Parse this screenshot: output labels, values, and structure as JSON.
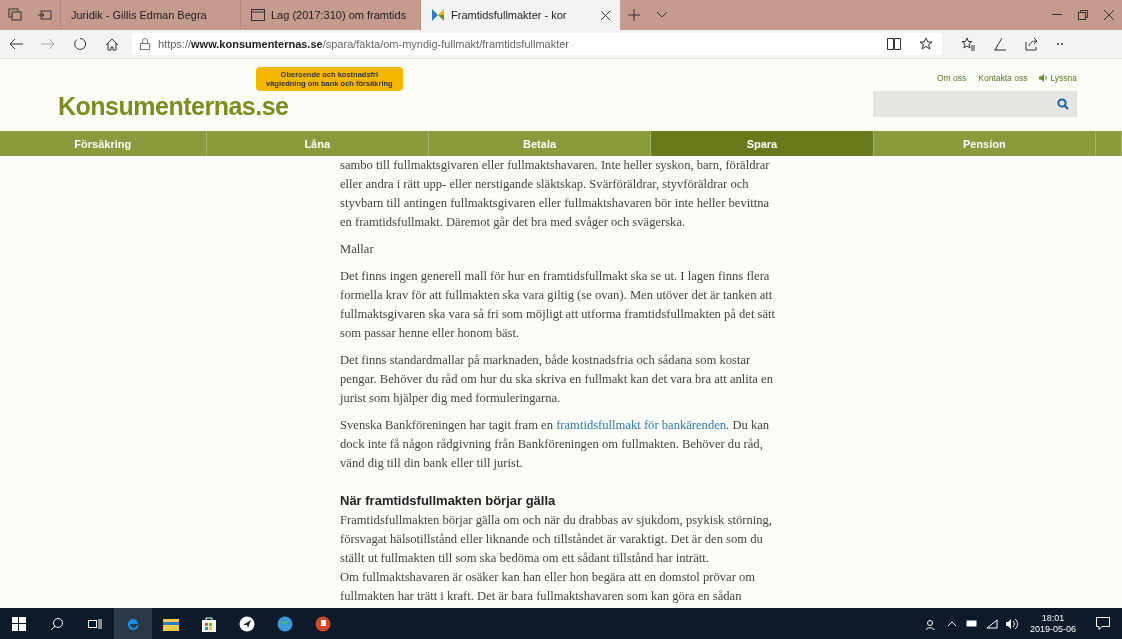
{
  "browser": {
    "tabs": [
      {
        "title": "Juridik - Gillis Edman Begra",
        "selected": false,
        "kind": "page"
      },
      {
        "title": "Lag (2017:310) om framtids",
        "selected": false,
        "kind": "window"
      },
      {
        "title": "Framtidsfullmakter - kor",
        "selected": true,
        "kind": "site"
      }
    ],
    "url_prefix": "https://",
    "url_domain": "www.konsumenternas.se",
    "url_path": "/spara/fakta/om-myndig-fullmakt/framtidsfullmakter"
  },
  "site": {
    "logo": "Konsumenternas.se",
    "bubble": [
      "Oberoende och kostnadsfri",
      "vägledning om bank och försäkring"
    ],
    "top_links": [
      {
        "label": "Om oss",
        "kind": "text"
      },
      {
        "label": "Kontakta oss",
        "kind": "text"
      },
      {
        "label": "Lyssna",
        "kind": "listen"
      }
    ],
    "nav": [
      {
        "label": "Försäkring",
        "selected": false
      },
      {
        "label": "Låna",
        "selected": false
      },
      {
        "label": "Betala",
        "selected": false
      },
      {
        "label": "Spara",
        "selected": true
      },
      {
        "label": "Pension",
        "selected": false
      }
    ]
  },
  "article": [
    {
      "kind": "paragraph",
      "lines": [
        "sambo till fullmaktsgivaren eller fullmaktshavaren. Inte heller syskon, barn, föräldrar",
        "eller andra i rätt upp- eller nerstigande släktskap. Svärföräldrar, styvföräldrar och",
        "styvbarn till antingen fullmaktsgivaren eller fullmaktshavaren bör inte heller bevittna",
        "en framtidsfullmakt. Däremot går det bra med svåger och svägerska."
      ]
    },
    {
      "kind": "paragraph",
      "lines": [
        "Mallar"
      ]
    },
    {
      "kind": "paragraph",
      "lines": [
        "Det finns ingen generell mall för hur en framtidsfullmakt ska se ut. I lagen finns flera",
        "formella krav för att fullmakten ska vara giltig (se ovan). Men utöver det är tanken att",
        "fullmaktsgivaren ska vara så fri som möjligt att utforma framtidsfullmakten på det sätt",
        "som passar henne eller honom bäst."
      ]
    },
    {
      "kind": "paragraph",
      "lines": [
        "Det finns standardmallar på marknaden, både kostnadsfria och sådana som kostar",
        "pengar. Behöver du råd om hur du ska skriva en fullmakt kan det vara bra att anlita en",
        "jurist som hjälper dig med formuleringarna."
      ]
    },
    {
      "kind": "linked",
      "before": "Svenska Bankföreningen har tagit fram en ",
      "link": "framtidsfullmakt för bankärenden",
      "after": ". Du kan",
      "lines": [
        "dock inte få någon rådgivning från Bankföreningen om fullmakten. Behöver du råd,",
        "vänd dig till din bank eller till jurist."
      ]
    },
    {
      "kind": "heading",
      "text": "När framtidsfullmakten börjar gälla"
    },
    {
      "kind": "plain",
      "lines": [
        "Framtidsfullmakten börjar gälla om och när du drabbas av sjukdom, psykisk störning,",
        "försvagat hälsotillstånd eller liknande och tillståndet är varaktigt. Det är den som du",
        "ställt ut fullmakten till som ska bedöma om ett sådant tillstånd har inträtt."
      ]
    },
    {
      "kind": "plain",
      "lines": [
        "Om fullmaktshavaren är osäker kan han eller hon begära att en domstol prövar om",
        "fullmakten har trätt i kraft. Det är bara fullmaktshavaren som kan göra en sådan"
      ]
    }
  ],
  "taskbar": {
    "time": "18:01",
    "date": "2019-05-06"
  }
}
